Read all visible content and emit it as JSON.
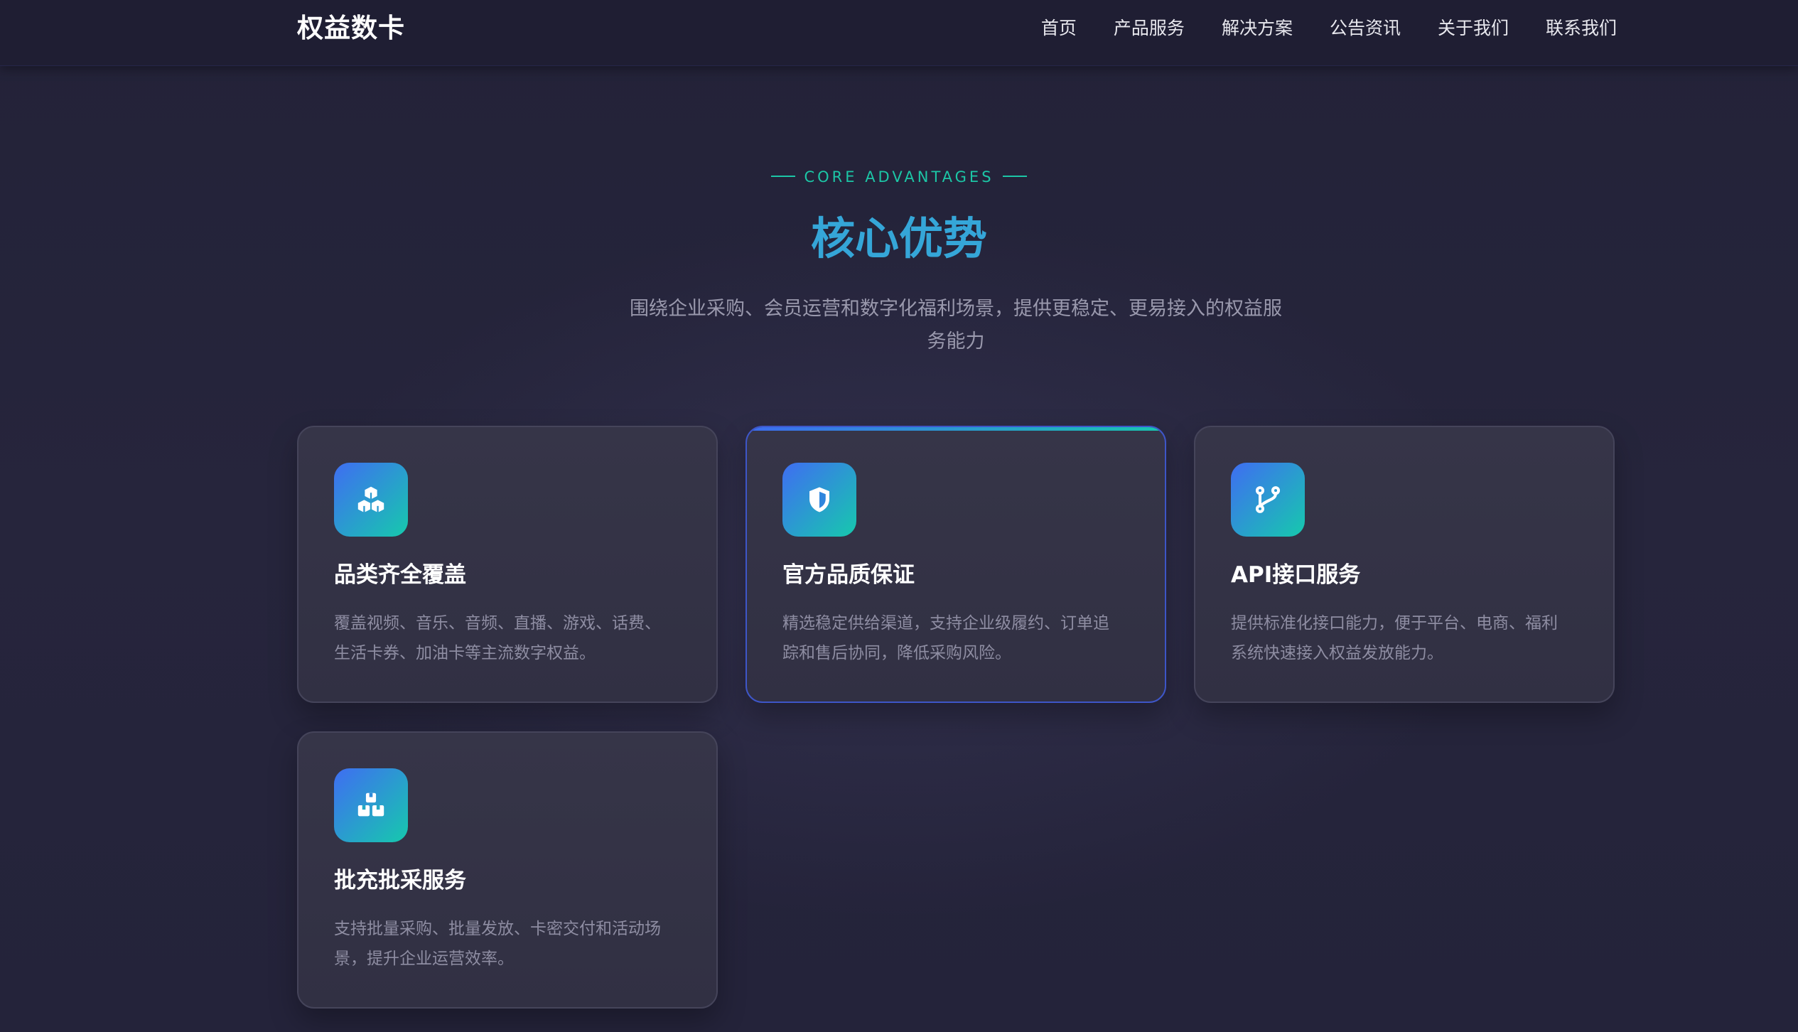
{
  "header": {
    "logo": "权益数卡",
    "nav": [
      "首页",
      "产品服务",
      "解决方案",
      "公告资讯",
      "关于我们",
      "联系我们"
    ]
  },
  "section": {
    "eyebrow": "CORE ADVANTAGES",
    "title": "核心优势",
    "subtitle_line1": "围绕企业采购、会员运营和数字化福利场景，提供更稳定、更易接入的权益服",
    "subtitle_line2": "务能力"
  },
  "cards": [
    {
      "icon": "boxes-icon",
      "title": "品类齐全覆盖",
      "desc_line1": "覆盖视频、音乐、音频、直播、游戏、话费、",
      "desc_line2": "生活卡券、加油卡等主流数字权益。"
    },
    {
      "icon": "shield-icon",
      "title": "官方品质保证",
      "desc_line1": "精选稳定供给渠道，支持企业级履约、订单追",
      "desc_line2": "踪和售后协同，降低采购风险。"
    },
    {
      "icon": "git-branch-icon",
      "title": "API接口服务",
      "desc_line1": "提供标准化接口能力，便于平台、电商、福利",
      "desc_line2": "系统快速接入权益发放能力。"
    },
    {
      "icon": "batch-boxes-icon",
      "title": "批充批采服务",
      "desc_line1": "支持批量采购、批量发放、卡密交付和活动场",
      "desc_line2": "景，提升企业运营效率。"
    }
  ],
  "colors": {
    "accent_teal": "#1cc6a6",
    "title_blue": "#35a6d8",
    "icon_gradient_start": "#3f6df2",
    "icon_gradient_end": "#16c9ad",
    "active_border": "#3e56c8"
  }
}
